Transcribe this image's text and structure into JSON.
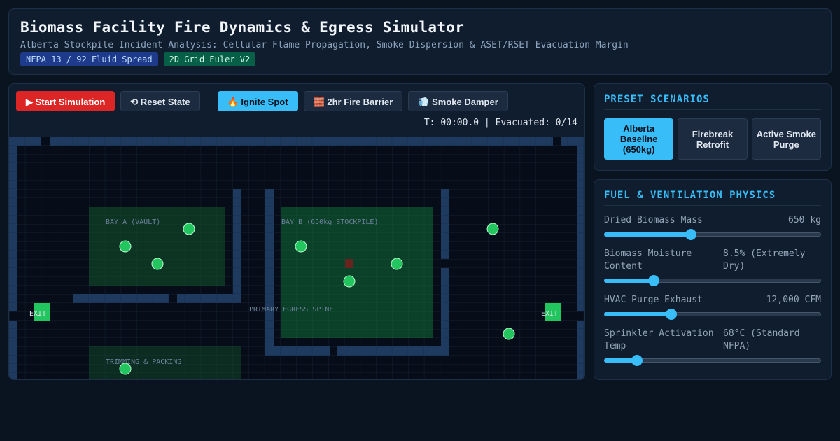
{
  "header": {
    "title": "Biomass Facility Fire Dynamics & Egress Simulator",
    "subtitle": "Alberta Stockpile Incident Analysis: Cellular Flame Propagation, Smoke Dispersion & ASET/RSET Evacuation Margin",
    "tags": [
      "NFPA 13 / 92 Fluid Spread",
      "2D Grid Euler V2"
    ]
  },
  "toolbar": {
    "start": "▶ Start Simulation",
    "reset": "⟲ Reset State",
    "ignite": "🔥 Ignite Spot",
    "barrier": "🧱 2hr Fire Barrier",
    "damper": "💨 Smoke Damper"
  },
  "status": {
    "text": "T: 00:00.0 | Evacuated: 0/14"
  },
  "map": {
    "labels": {
      "bay_a": "BAY A (VAULT)",
      "bay_b": "BAY B (650kg STOCKPILE)",
      "spine": "PRIMARY EGRESS SPINE",
      "trimming": "TRIMMING & PACKING",
      "exit_left": "EXIT",
      "exit_right": "EXIT"
    },
    "colors": {
      "wall": "#1e3a5f",
      "zone": "#14532d",
      "occupant": "#22c55e",
      "exit": "#22c55e",
      "ignition": "#7f1d1d"
    }
  },
  "presets": {
    "title": "PRESET SCENARIOS",
    "items": [
      "Alberta Baseline (650kg)",
      "Firebreak Retrofit",
      "Active Smoke Purge"
    ],
    "active_index": 0
  },
  "physics": {
    "title": "FUEL & VENTILATION PHYSICS",
    "params": [
      {
        "label": "Dried Biomass Mass",
        "value": "650 kg",
        "level": 0.4
      },
      {
        "label": "Biomass Moisture Content",
        "value": "8.5% (Extremely Dry)",
        "level": 0.23
      },
      {
        "label": "HVAC Purge Exhaust",
        "value": "12,000 CFM",
        "level": 0.31
      },
      {
        "label": "Sprinkler Activation Temp",
        "value": "68°C (Standard NFPA)",
        "level": 0.15
      }
    ]
  }
}
